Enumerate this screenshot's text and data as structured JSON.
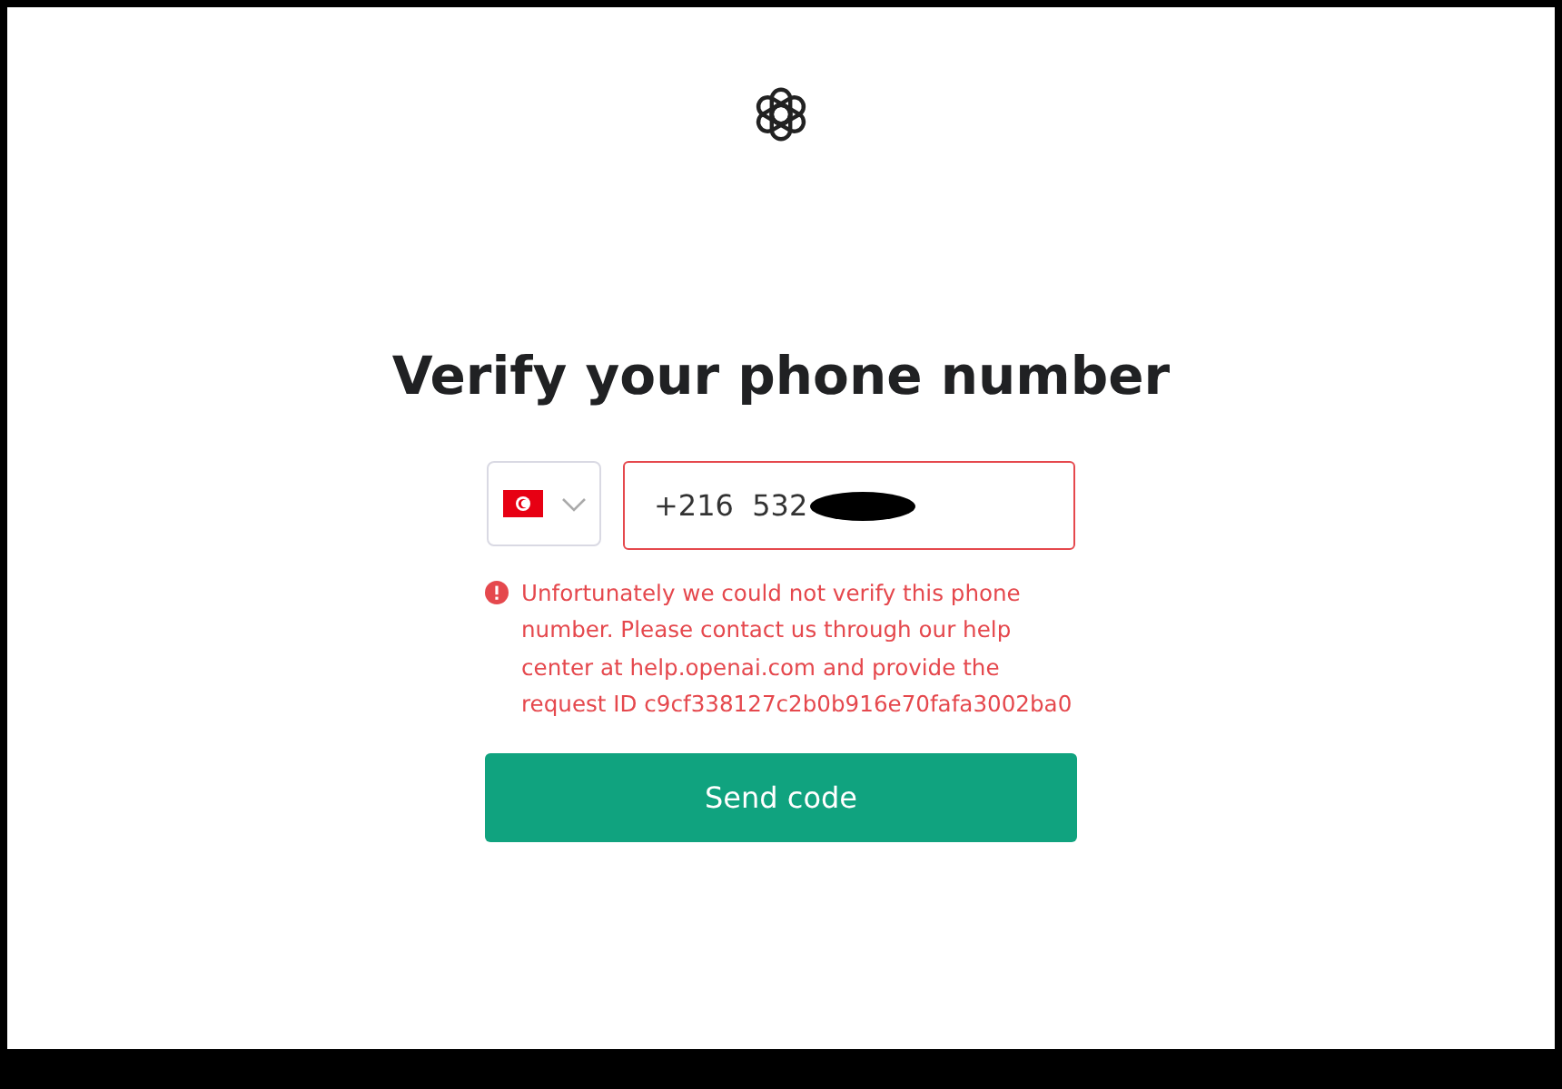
{
  "heading": "Verify your phone number",
  "phone_field": {
    "value": "+216  532",
    "redacted": true,
    "invalid": true
  },
  "error": {
    "message": "Unfortunately we could not verify this phone number. Please contact us through our help center at help.openai.com and provide the request ID c9cf338127c2b0b916e70fafa3002ba0"
  },
  "buttons": [
    {
      "label": "Send code"
    }
  ]
}
